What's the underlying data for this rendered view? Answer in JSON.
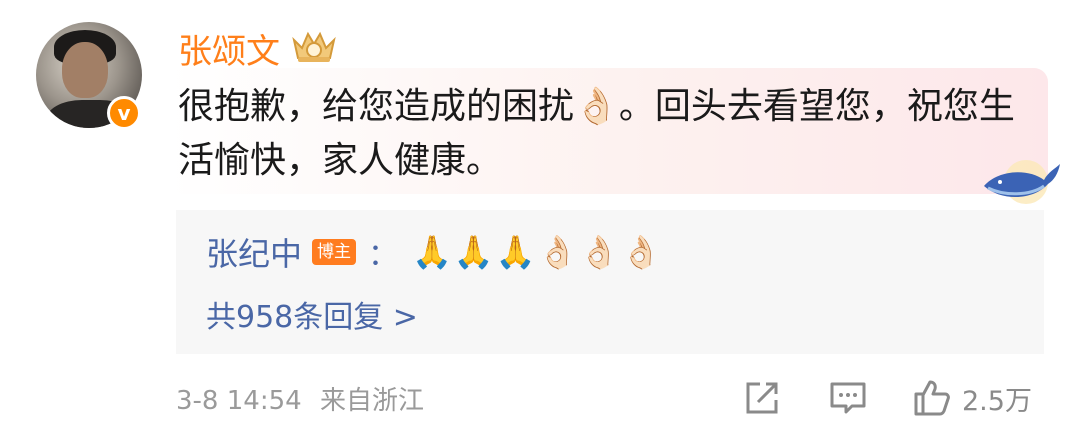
{
  "comment": {
    "username": "张颂文",
    "text": "很抱歉，给您造成的困扰👌🏻。回头去看望您，祝您生活愉快，家人健康。",
    "verified_mark": "v",
    "badge_icon": "crown-icon"
  },
  "reply": {
    "replier": "张纪中",
    "role_badge": "博主",
    "colon": "：",
    "emojis": "🙏🙏🙏👌🏻👌🏻👌🏻",
    "reply_count": "共958条回复 >"
  },
  "footer": {
    "date": "3-8 14:54",
    "location": "来自浙江",
    "share_icon": "share-icon",
    "comment_icon": "comment-icon",
    "like_icon": "thumbs-up-icon",
    "like_count": "2.5万"
  },
  "colors": {
    "username": "#ff7f1a",
    "link": "#4a67a6",
    "meta": "#9a9a9a",
    "reply_bg": "#f7f7f7"
  }
}
